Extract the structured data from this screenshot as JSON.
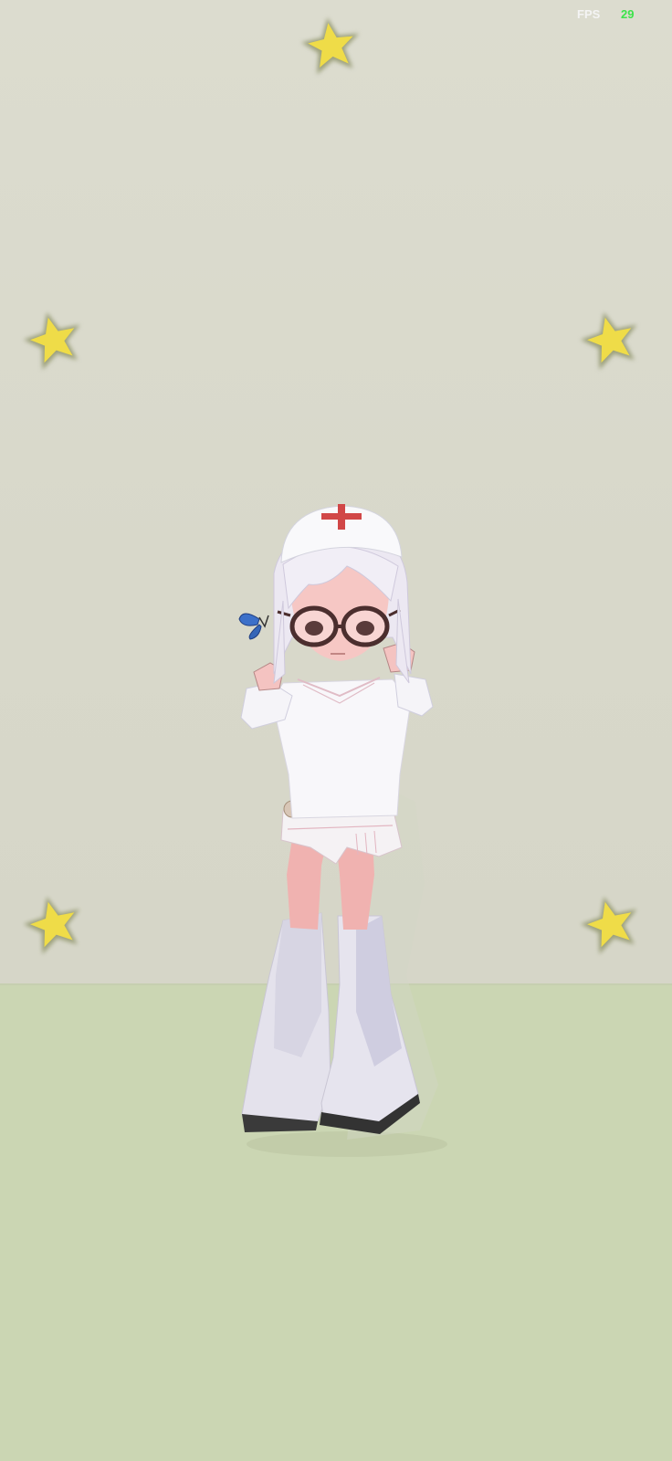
{
  "hud": {
    "fps_label": "FPS",
    "fps_value": "29",
    "fps_value_color": "#3ce34a"
  },
  "scene": {
    "wall_color": "#dcdbcd",
    "floor_color": "#cbd6b3",
    "star_color": "#efdc48",
    "star_glow_color": "#9aa07a",
    "star_count": 5,
    "character": {
      "icon": "nurse-character",
      "accessories": [
        "nurse-cap-cross-icon",
        "glasses-icon",
        "butterfly-icon"
      ]
    }
  }
}
